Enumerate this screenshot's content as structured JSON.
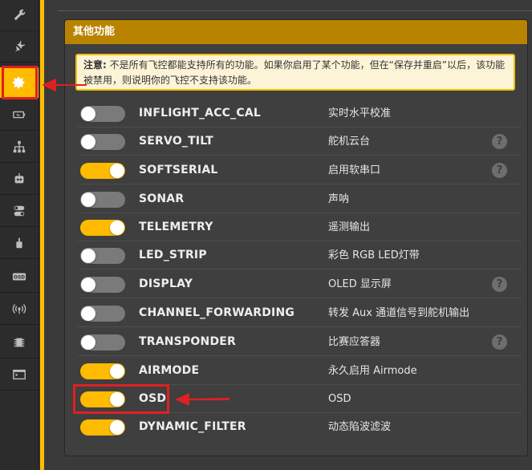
{
  "sidebar": {
    "items": [
      {
        "icon": "wrench-icon"
      },
      {
        "icon": "plug-icon"
      },
      {
        "icon": "gear-icon",
        "active": true
      },
      {
        "icon": "battery-icon"
      },
      {
        "icon": "network-icon"
      },
      {
        "icon": "robot-icon"
      },
      {
        "icon": "switches-icon"
      },
      {
        "icon": "motor-icon"
      },
      {
        "icon": "osd-icon",
        "label": "OSD"
      },
      {
        "icon": "signal-icon"
      },
      {
        "icon": "chip-icon"
      },
      {
        "icon": "terminal-icon"
      }
    ]
  },
  "panel": {
    "title": "其他功能",
    "note_bold": "注意:",
    "note_text": " 不是所有飞控都能支持所有的功能。如果你启用了某个功能，但在“保存并重启”以后，该功能被禁用，则说明你的飞控不支持该功能。"
  },
  "features": [
    {
      "name": "INFLIGHT_ACC_CAL",
      "desc": "实时水平校准",
      "enabled": false,
      "help": false
    },
    {
      "name": "SERVO_TILT",
      "desc": "舵机云台",
      "enabled": false,
      "help": true
    },
    {
      "name": "SOFTSERIAL",
      "desc": "启用软串口",
      "enabled": true,
      "help": true
    },
    {
      "name": "SONAR",
      "desc": "声呐",
      "enabled": false,
      "help": false
    },
    {
      "name": "TELEMETRY",
      "desc": "遥测输出",
      "enabled": true,
      "help": false
    },
    {
      "name": "LED_STRIP",
      "desc": "彩色 RGB LED灯带",
      "enabled": false,
      "help": false
    },
    {
      "name": "DISPLAY",
      "desc": "OLED 显示屏",
      "enabled": false,
      "help": true
    },
    {
      "name": "CHANNEL_FORWARDING",
      "desc": "转发 Aux 通道信号到舵机输出",
      "enabled": false,
      "help": false
    },
    {
      "name": "TRANSPONDER",
      "desc": "比赛应答器",
      "enabled": false,
      "help": true
    },
    {
      "name": "AIRMODE",
      "desc": "永久启用 Airmode",
      "enabled": true,
      "help": false
    },
    {
      "name": "OSD",
      "desc": "OSD",
      "enabled": true,
      "help": false
    },
    {
      "name": "DYNAMIC_FILTER",
      "desc": "动态陷波滤波",
      "enabled": true,
      "help": false
    }
  ],
  "help_glyph": "?",
  "colors": {
    "accent": "#ffbb00",
    "header": "#b88400",
    "annotation": "#e02020"
  }
}
